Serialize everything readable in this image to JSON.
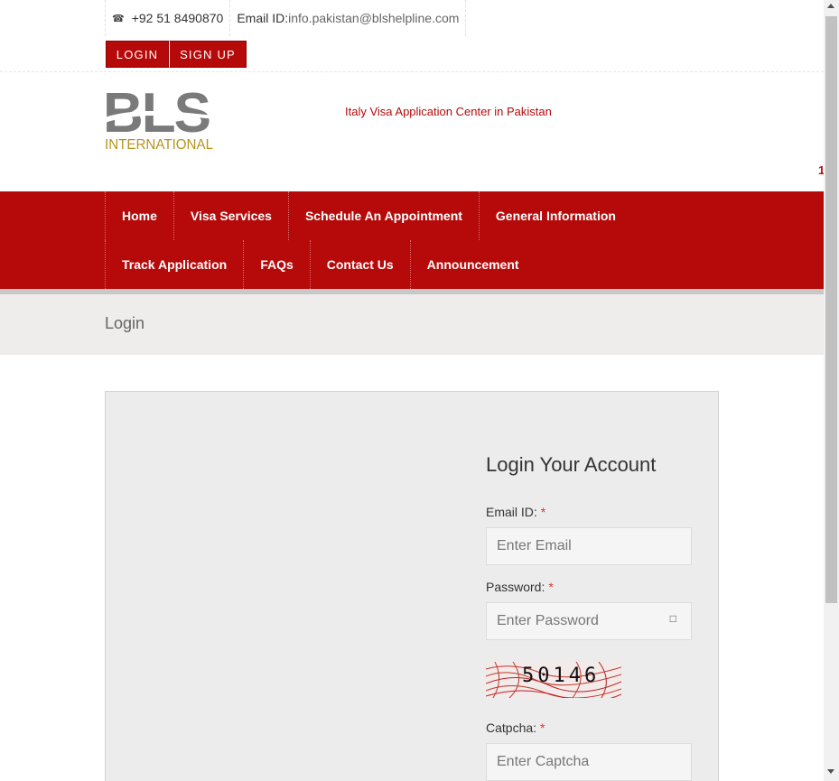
{
  "topbar": {
    "phone_icon": "phone-icon",
    "phone": "+92 51 8490870",
    "email_label": "Email ID:",
    "email_value": "info.pakistan@blshelpline.com",
    "login_label": "LOGIN",
    "signup_label": "SIGN UP"
  },
  "header": {
    "logo_text": "BLS",
    "logo_subtext": "INTERNATIONAL",
    "tagline": "Italy Visa Application Center in Pakistan",
    "edge_text": "1"
  },
  "nav": {
    "row1": [
      "Home",
      "Visa Services",
      "Schedule An Appointment",
      "General Information"
    ],
    "row2": [
      "Track Application",
      "FAQs",
      "Contact Us",
      "Announcement"
    ]
  },
  "breadcrumb": {
    "title": "Login"
  },
  "form": {
    "heading": "Login Your Account",
    "email_label": "Email ID:",
    "email_placeholder": "Enter Email",
    "password_label": "Password:",
    "password_placeholder": "Enter Password",
    "captcha_image_text": "50146",
    "captcha_label": "Catpcha:",
    "captcha_placeholder": "Enter Captcha",
    "required_mark": "*"
  },
  "colors": {
    "brand_red": "#b60a0a",
    "logo_gray": "#7a7a7a",
    "logo_gold": "#b8941f",
    "panel_bg": "#ececec"
  }
}
